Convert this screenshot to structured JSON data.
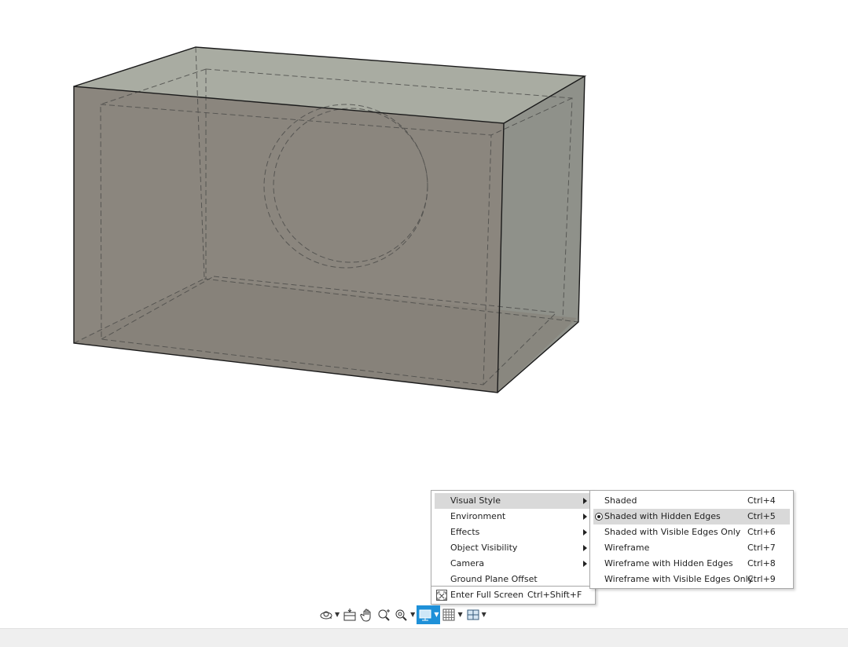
{
  "menu": {
    "items": [
      {
        "label": "Visual Style",
        "has_submenu": true
      },
      {
        "label": "Environment",
        "has_submenu": true
      },
      {
        "label": "Effects",
        "has_submenu": true
      },
      {
        "label": "Object Visibility",
        "has_submenu": true
      },
      {
        "label": "Camera",
        "has_submenu": true
      },
      {
        "label": "Ground Plane Offset",
        "has_submenu": false
      }
    ],
    "fullscreen": {
      "label": "Enter Full Screen",
      "shortcut": "Ctrl+Shift+F",
      "icon": "fullscreen-icon"
    }
  },
  "visual_style_submenu": {
    "items": [
      {
        "label": "Shaded",
        "shortcut": "Ctrl+4"
      },
      {
        "label": "Shaded with Hidden Edges",
        "shortcut": "Ctrl+5",
        "selected": true
      },
      {
        "label": "Shaded with Visible Edges Only",
        "shortcut": "Ctrl+6"
      },
      {
        "label": "Wireframe",
        "shortcut": "Ctrl+7"
      },
      {
        "label": "Wireframe with Hidden Edges",
        "shortcut": "Ctrl+8"
      },
      {
        "label": "Wireframe with Visible Edges Only",
        "shortcut": "Ctrl+9"
      }
    ]
  },
  "toolbar": {
    "tools": [
      "orbit-icon",
      "look-at-icon",
      "pan-icon",
      "zoom-icon",
      "fit-icon",
      "display-settings-icon",
      "grid-icon",
      "viewports-icon"
    ],
    "active_tool": "display-settings-icon",
    "accent_color": "#1e90d8"
  },
  "colors": {
    "body_fill": "#8c877f",
    "top_fill": "#a8aba1",
    "side_fill": "#8f918a",
    "menu_highlight": "#d9d9d9"
  }
}
